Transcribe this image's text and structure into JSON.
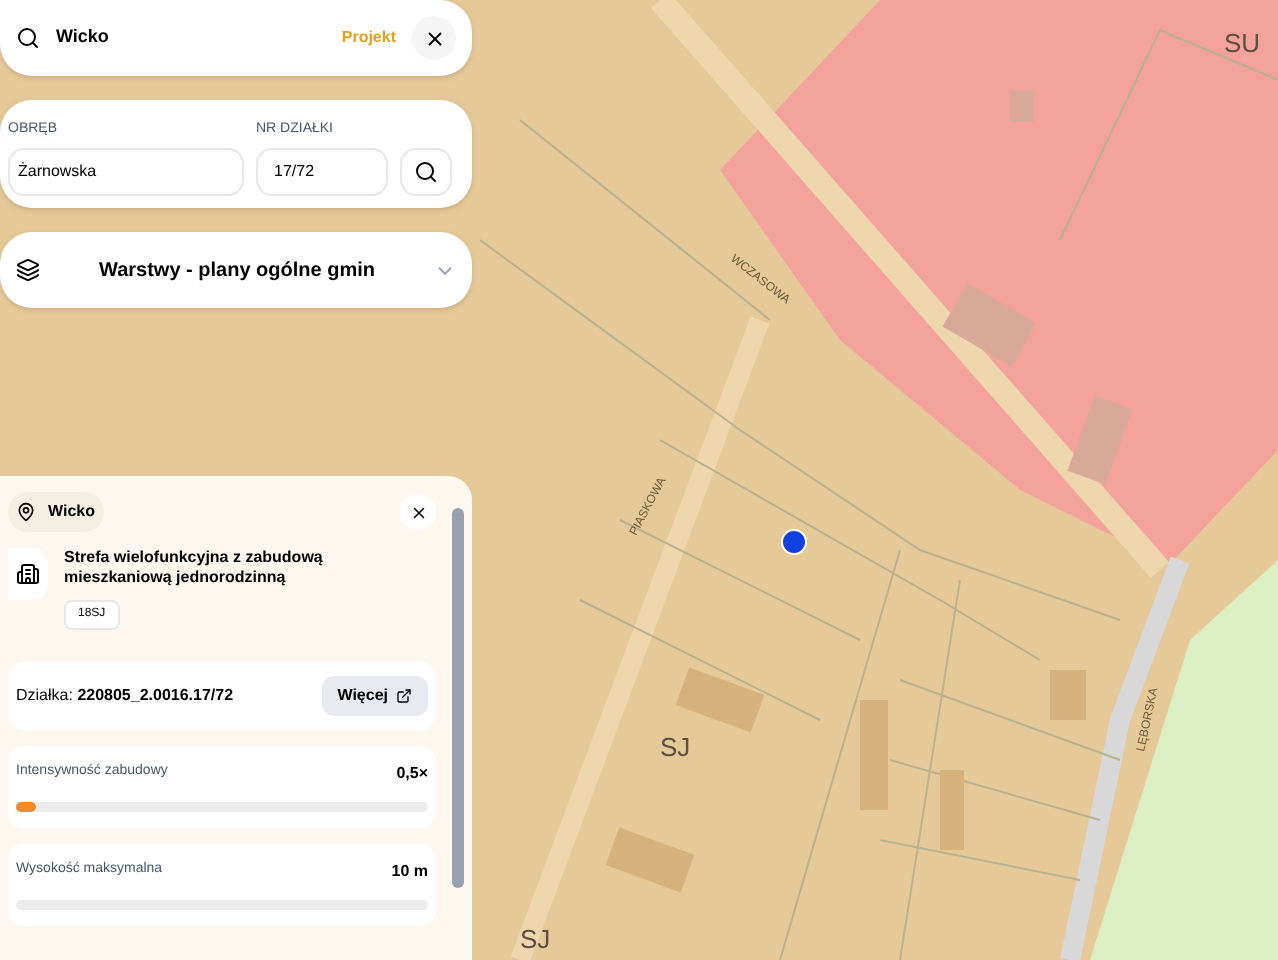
{
  "search": {
    "value": "Wicko",
    "badge": "Projekt"
  },
  "address": {
    "street_label": "OBRĘB",
    "street_value": "Żarnowska",
    "parcel_label": "NR DZIAŁKI",
    "parcel_value": "17/72"
  },
  "layers": {
    "label": "Warstwy - plany ogólne gmin",
    "expanded": false
  },
  "map": {
    "labels": [
      {
        "text": "SU",
        "kind": "zone"
      },
      {
        "text": "SJ",
        "kind": "zone"
      },
      {
        "text": "SJ",
        "kind": "zone"
      },
      {
        "text": "WCZASOWA",
        "kind": "street"
      },
      {
        "text": "PIASKOWA",
        "kind": "street"
      },
      {
        "text": "LĘBORSKA",
        "kind": "street"
      }
    ]
  },
  "panel": {
    "place": "Wicko",
    "title": "Strefa wielofunkcyjna z zabudową mieszkaniową jednorodzinną",
    "code": "18SJ",
    "parcel": "Działka: **220805_2.0016.17/72**",
    "more": "Więcej",
    "metrics": [
      {
        "label": "Intensywność zabudowy",
        "value": "0,5×",
        "level": 0.05
      },
      {
        "label": "Wysokość maksymalna",
        "value": "10 m",
        "level": 0
      }
    ]
  }
}
